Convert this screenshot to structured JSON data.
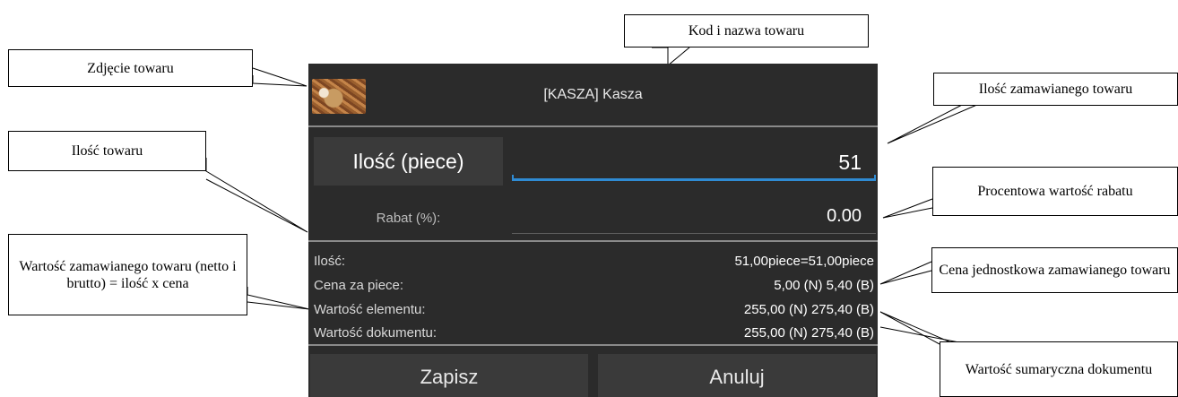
{
  "dialog": {
    "title": "[KASZA] Kasza",
    "quantity_button": "Ilość (piece)",
    "quantity_value": "51",
    "discount_label": "Rabat (%):",
    "discount_value": "0.00",
    "info": [
      {
        "label": "Ilość:",
        "value": "51,00piece=51,00piece"
      },
      {
        "label": "Cena za piece:",
        "value": "5,00 (N)  5,40 (B)"
      },
      {
        "label": "Wartość elementu:",
        "value": "255,00 (N) 275,40 (B)"
      },
      {
        "label": "Wartość dokumentu:",
        "value": "255,00 (N) 275,40 (B)"
      }
    ],
    "save_label": "Zapisz",
    "cancel_label": "Anuluj"
  },
  "callouts": {
    "product_code_name": "Kod i nazwa towaru",
    "product_photo": "Zdjęcie towaru",
    "ordered_quantity": "Ilość zamawianego towaru",
    "product_quantity": "Ilość towaru",
    "discount_percent": "Procentowa wartość rabatu",
    "ordered_value": "Wartość zamawianego towaru (netto i brutto) = ilość x cena",
    "unit_price": "Cena jednostkowa zamawianego towaru",
    "document_total": "Wartość sumaryczna dokumentu"
  }
}
